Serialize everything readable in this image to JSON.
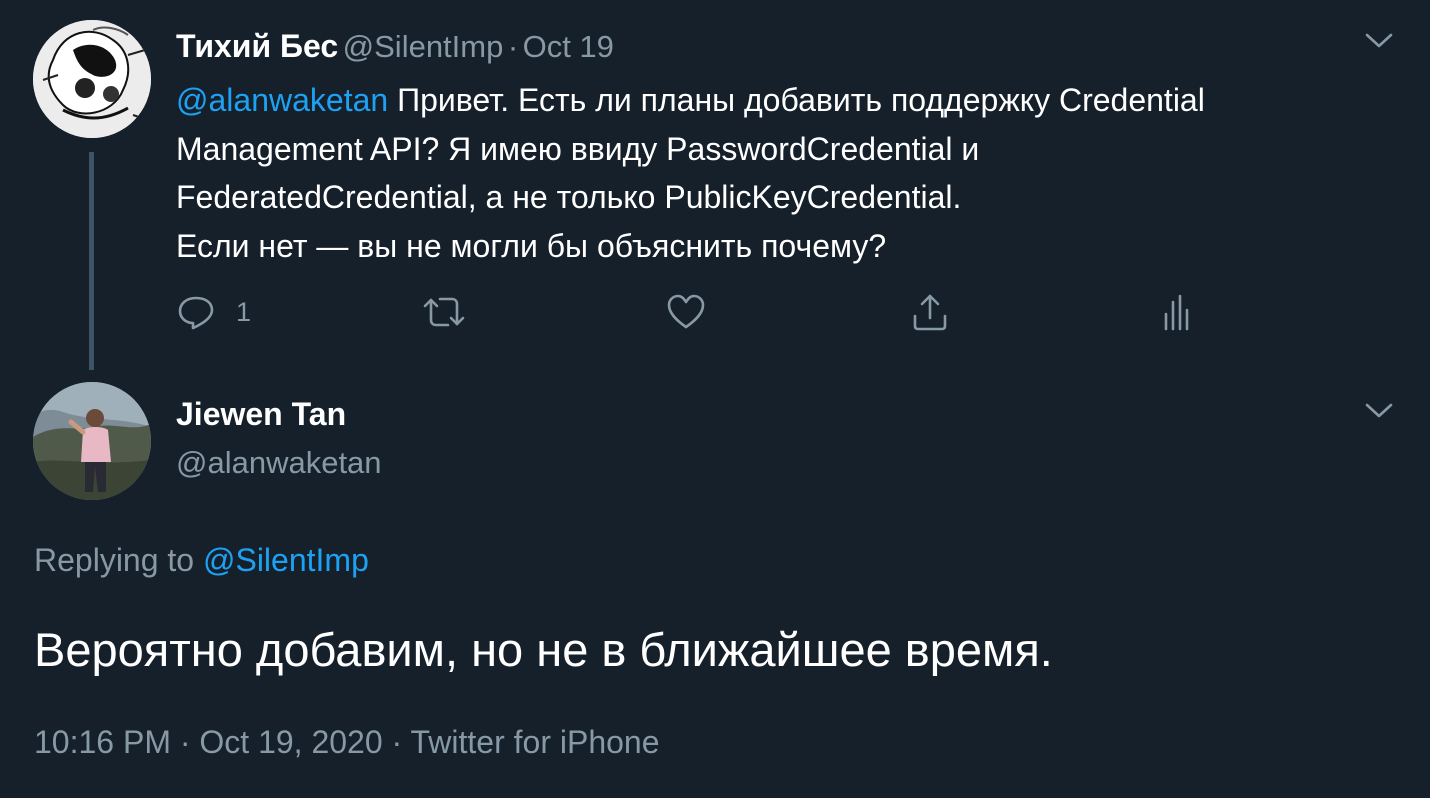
{
  "parent_tweet": {
    "author_name": "Тихий Бес",
    "author_handle": "@SilentImp",
    "separator": "·",
    "date": "Oct 19",
    "mention": "@alanwaketan",
    "text_line1_rest": " Привет. Есть ли планы добавить поддержку Credential",
    "text_line2": "Management API? Я имею ввиду PasswordCredential и",
    "text_line3": "FederatedCredential, а не только PublicKeyCredential.",
    "text_line4": "Если нет — вы не могли бы объяснить почему?",
    "reply_count": "1",
    "icons": {
      "reply": "reply-icon",
      "retweet": "retweet-icon",
      "like": "like-icon",
      "share": "share-icon",
      "analytics": "analytics-icon",
      "menu": "chevron-down-icon"
    }
  },
  "main_tweet": {
    "author_name": "Jiewen Tan",
    "author_handle": "@alanwaketan",
    "replying_prefix": "Replying to ",
    "replying_handle": "@SilentImp",
    "text": "Вероятно добавим, но не в ближайшее время.",
    "time": "10:16 PM",
    "separator": "·",
    "date": "Oct 19, 2020",
    "source": "Twitter for iPhone"
  },
  "colors": {
    "background": "#15202b",
    "text_primary": "#ffffff",
    "text_secondary": "#8899a6",
    "accent": "#1da1f2",
    "thread_line": "#3d5466"
  }
}
